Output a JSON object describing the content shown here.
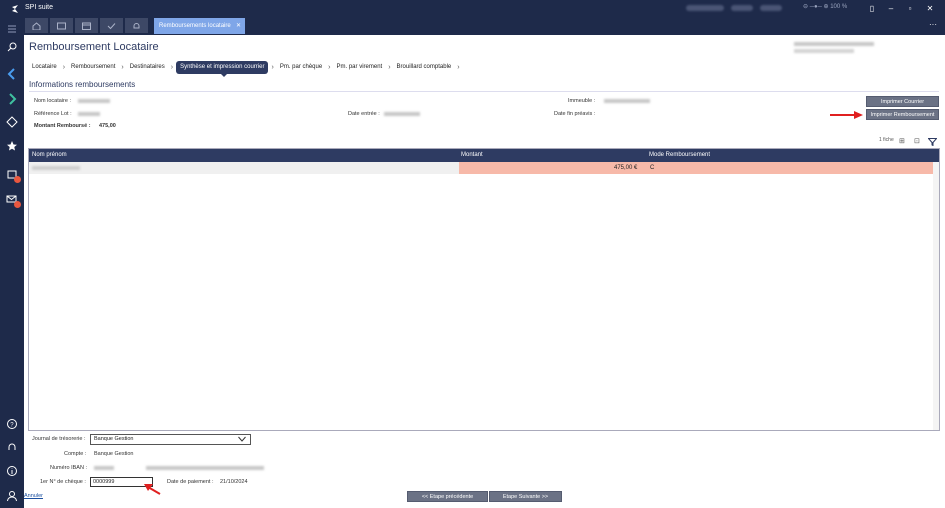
{
  "app": {
    "title": "SPI suite",
    "zoom": "100 %"
  },
  "tabs": {
    "active_label": "Remboursements locataire",
    "close": "✕"
  },
  "page": {
    "title": "Remboursement Locataire"
  },
  "steps": [
    "Locataire",
    "Remboursement",
    "Destinataires",
    "Synthèse et impression courrier",
    "Pm. par chèque",
    "Pm. par virement",
    "Brouillard comptable"
  ],
  "info": {
    "section_title": "Informations remboursements",
    "nom_locataire": "Nom locataire :",
    "reference_lot": "Référence Lot :",
    "montant_label": "Montant Remboursé :",
    "montant_value": "475,00",
    "date_entree": "Date entrée :",
    "immeuble": "Immeuble :",
    "date_fin_preavis": "Date fin préavis :"
  },
  "buttons": {
    "imprimer_courrier": "Imprimer Courrier",
    "imprimer_remboursement": "Imprimer Remboursement"
  },
  "grid": {
    "count": "1 fiche",
    "headers": [
      "Nom prénom",
      "Montant",
      "Mode Remboursement"
    ],
    "rows": [
      {
        "amount": "475,00 €",
        "mode": "C"
      }
    ]
  },
  "footer": {
    "journal_label": "Journal de trésorerie :",
    "journal_value": "Banque Gestion",
    "compte_label": "Compte :",
    "compte_value": "Banque Gestion",
    "iban_label": "Numéro IBAN :",
    "cheque_label": "1er N° de chèque :",
    "cheque_value": "0000999",
    "date_paiement_label": "Date de paiement :",
    "date_paiement_value": "21/10/2024",
    "prev_label": "<< Etape précédente",
    "next_label": "Etape Suivante >>",
    "cancel_label": "Annuler"
  },
  "colors": {
    "navy": "#2e3b62",
    "highlight": "#f7b9a9",
    "accent_tab": "#7fa6e8",
    "arrow": "#e02020"
  }
}
